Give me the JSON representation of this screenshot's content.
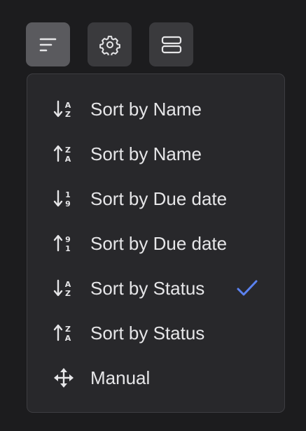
{
  "colors": {
    "background": "#1c1c1e",
    "button": "#3a3a3d",
    "button_active": "#5a5a5e",
    "menu_bg": "#28282b",
    "text": "#e6e6e8",
    "check": "#5b82f0"
  },
  "toolbar": {
    "sort_icon": "sort-lines-icon",
    "settings_icon": "gear-icon",
    "layout_icon": "rows-layout-icon"
  },
  "menu": {
    "items": [
      {
        "label": "Sort by Name",
        "icon": "sort-alpha-down-icon",
        "checked": false
      },
      {
        "label": "Sort by Name",
        "icon": "sort-alpha-up-icon",
        "checked": false
      },
      {
        "label": "Sort by Due date",
        "icon": "sort-numeric-down-icon",
        "checked": false
      },
      {
        "label": "Sort by Due date",
        "icon": "sort-numeric-up-icon",
        "checked": false
      },
      {
        "label": "Sort by Status",
        "icon": "sort-alpha-down-icon",
        "checked": true
      },
      {
        "label": "Sort by Status",
        "icon": "sort-alpha-up-icon",
        "checked": false
      },
      {
        "label": "Manual",
        "icon": "move-arrows-icon",
        "checked": false
      }
    ]
  }
}
